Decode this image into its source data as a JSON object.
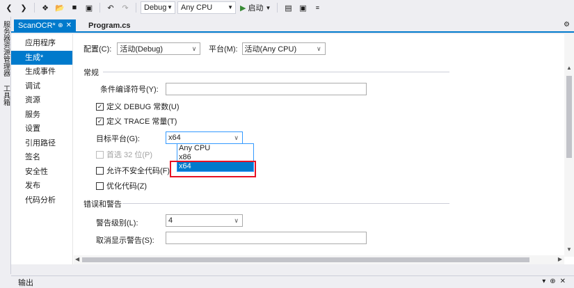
{
  "toolbar": {
    "config_value": "Debug",
    "platform_value": "Any CPU",
    "start_label": "启动"
  },
  "left_strip": {
    "tabs": [
      "服务器资源管理器",
      "工具箱"
    ]
  },
  "tabs": {
    "active_label": "ScanOCR*",
    "inactive_label": "Program.cs"
  },
  "nav": {
    "items": [
      "应用程序",
      "生成*",
      "生成事件",
      "调试",
      "资源",
      "服务",
      "设置",
      "引用路径",
      "签名",
      "安全性",
      "发布",
      "代码分析"
    ],
    "selected_index": 1
  },
  "config_row": {
    "config_label": "配置(C):",
    "config_value": "活动(Debug)",
    "platform_label": "平台(M):",
    "platform_value": "活动(Any CPU)"
  },
  "general": {
    "title": "常规",
    "conditional_symbols_label": "条件编译符号(Y):",
    "conditional_symbols_value": "",
    "define_debug_label": "定义 DEBUG 常数(U)",
    "define_debug_checked": true,
    "define_trace_label": "定义 TRACE 常量(T)",
    "define_trace_checked": true,
    "target_platform_label": "目标平台(G):",
    "target_platform_value": "x64",
    "prefer32_label": "首选 32 位(P)",
    "allow_unsafe_label": "允许不安全代码(F)",
    "optimize_label": "优化代码(Z)"
  },
  "dropdown": {
    "options": [
      "Any CPU",
      "x86",
      "x64"
    ],
    "highlighted_index": 2
  },
  "errors": {
    "title": "错误和警告",
    "warning_level_label": "警告级别(L):",
    "warning_level_value": "4",
    "suppress_label": "取消显示警告(S):",
    "suppress_value": ""
  },
  "output_panel": {
    "label": "输出"
  }
}
